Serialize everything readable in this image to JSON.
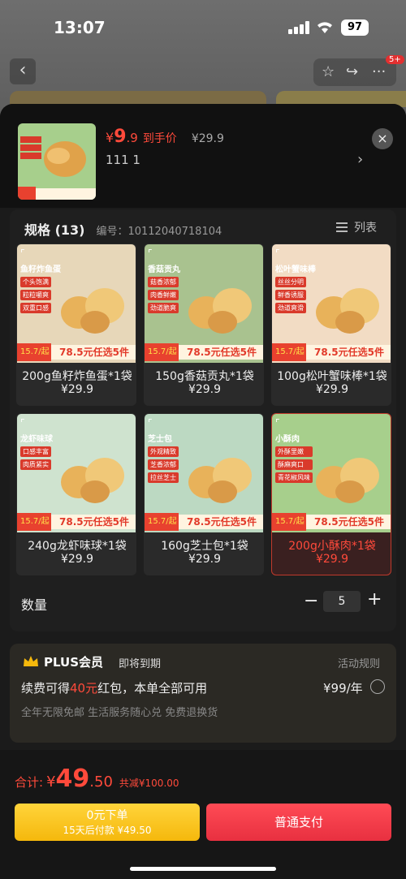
{
  "status_bar": {
    "time": "13:07",
    "battery": "97"
  },
  "background_nav": {
    "back": "‹",
    "cart_badge": "5+"
  },
  "product": {
    "currency": "¥",
    "price_int": "9",
    "price_dec": ".9",
    "price_tag": "到手价",
    "original_price": "¥29.9",
    "sku_line": "111  1",
    "sku_arrow": "›",
    "close": "×"
  },
  "spec": {
    "title": "规格 (13)",
    "code": "编号：10112040718104",
    "list_toggle": "列表",
    "items": [
      {
        "name": "200g鱼籽炸鱼蛋*1袋",
        "price": "¥29.9",
        "label": "鱼籽炸鱼蛋",
        "tags": [
          "个头饱满",
          "粒粒嚼爽",
          "双重口感"
        ],
        "promo_price": "15.7/起",
        "promo_text": "78.5元任选5件",
        "color": "#e7d7b9",
        "selected": false
      },
      {
        "name": "150g香菇贡丸*1袋",
        "price": "¥29.9",
        "label": "香菇贡丸",
        "tags": [
          "菇香浓郁",
          "肉香鲜嫩",
          "劲道脆爽"
        ],
        "promo_price": "15.7/起",
        "promo_text": "78.5元任选5件",
        "color": "#a9c28f",
        "selected": false
      },
      {
        "name": "100g松叶蟹味棒*1袋",
        "price": "¥29.9",
        "label": "松叶蟹味棒",
        "tags": [
          "丝丝分明",
          "鲜香诱服",
          "劲道爽滑"
        ],
        "promo_price": "15.7/起",
        "promo_text": "78.5元任选5件",
        "color": "#f2dcc4",
        "selected": false
      },
      {
        "name": "240g龙虾味球*1袋",
        "price": "¥29.9",
        "label": "龙虾味球",
        "tags": [
          "口感丰富",
          "肉质紧实"
        ],
        "promo_price": "15.7/起",
        "promo_text": "78.5元任选5件",
        "color": "#cfe3cf",
        "selected": false
      },
      {
        "name": "160g芝士包*1袋",
        "price": "¥29.9",
        "label": "芝士包",
        "tags": [
          "外观精致",
          "芝香浓郁",
          "拉丝芝士"
        ],
        "promo_price": "15.7/起",
        "promo_text": "78.5元任选5件",
        "color": "#bcd9c2",
        "selected": false
      },
      {
        "name": "200g小酥肉*1袋",
        "price": "¥29.9",
        "label": "小酥肉",
        "tags": [
          "外酥里嫩",
          "酥麻爽口",
          "青花椒风味"
        ],
        "promo_price": "15.7/起",
        "promo_text": "78.5元任选5件",
        "color": "#a7cf8c",
        "selected": true
      }
    ]
  },
  "quantity": {
    "label": "数量",
    "minus": "−",
    "value": "5",
    "plus": "+"
  },
  "plus": {
    "title": "PLUS会员",
    "expire": "即将到期",
    "rules": "活动规则",
    "renew_prefix": "续费可得",
    "renew_amount": "40元",
    "renew_suffix": "红包，本单全部可用",
    "fee": "¥99/年",
    "benefits": "全年无限免邮  生活服务随心兑  免费退换货"
  },
  "footer": {
    "total_label": "合计:",
    "total_currency": "¥",
    "total_int": "49",
    "total_dec": ".50",
    "total_save": "共减¥100.00",
    "credit_line1": "0元下单",
    "credit_line2": "15天后付款 ¥49.50",
    "pay_label": "普通支付"
  },
  "colors": {
    "accent": "#ff4a3b",
    "sheet_bg": "#1b1b1b",
    "selected_border": "#c0392b",
    "credit_btn": "#f5b80c",
    "pay_btn": "#e83040"
  }
}
